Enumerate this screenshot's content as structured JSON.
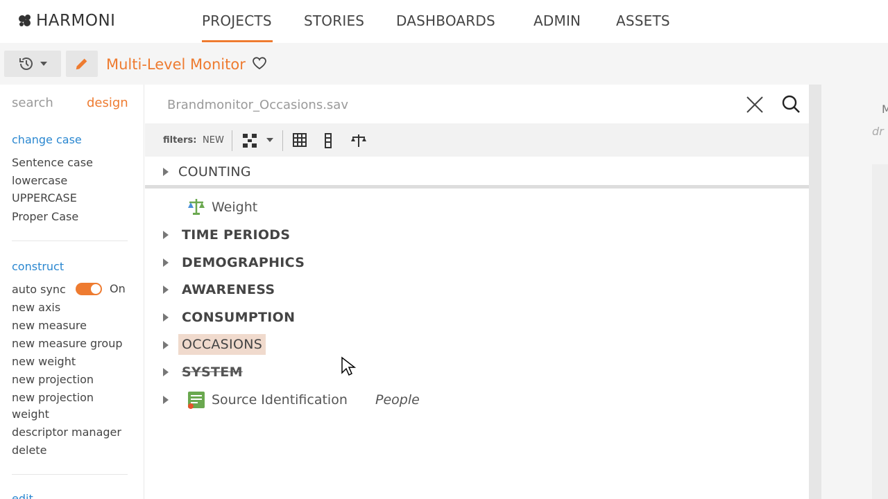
{
  "brand": {
    "name": "HARMONI"
  },
  "nav": {
    "items": [
      {
        "label": "PROJECTS",
        "active": true
      },
      {
        "label": "STORIES",
        "active": false
      },
      {
        "label": "DASHBOARDS",
        "active": false
      },
      {
        "label": "ADMIN",
        "active": false
      },
      {
        "label": "ASSETS",
        "active": false
      }
    ]
  },
  "toolbar": {
    "project_title": "Multi-Level Monitor"
  },
  "left_panel": {
    "tabs": {
      "search": "search",
      "design": "design",
      "active": "design"
    },
    "change_case": {
      "heading": "change case",
      "items": [
        "Sentence case",
        "lowercase",
        "UPPERCASE",
        "Proper Case"
      ]
    },
    "construct": {
      "heading": "construct",
      "auto_sync_label": "auto sync",
      "auto_sync_state": "On",
      "items": [
        "new axis",
        "new measure",
        "new measure group",
        "new weight",
        "new projection",
        "new projection",
        "weight",
        "descriptor manager",
        "delete"
      ]
    },
    "edit_heading": "edit"
  },
  "center": {
    "file_title": "Brandmonitor_Occasions.sav",
    "filters_label": "filters:",
    "filters_new": "NEW",
    "tree": {
      "counting": "COUNTING",
      "weight": "Weight",
      "groups": [
        "TIME PERIODS",
        "DEMOGRAPHICS",
        "AWARENESS",
        "CONSUMPTION",
        "OCCASIONS",
        "SYSTEM"
      ],
      "source": {
        "label": "Source Identification",
        "type": "People"
      }
    }
  },
  "right_panel": {
    "fragment_1": "M",
    "fragment_2": "dr"
  },
  "colors": {
    "accent": "#ee7b30",
    "link": "#2a87d0",
    "highlight": "#f0dacd"
  }
}
